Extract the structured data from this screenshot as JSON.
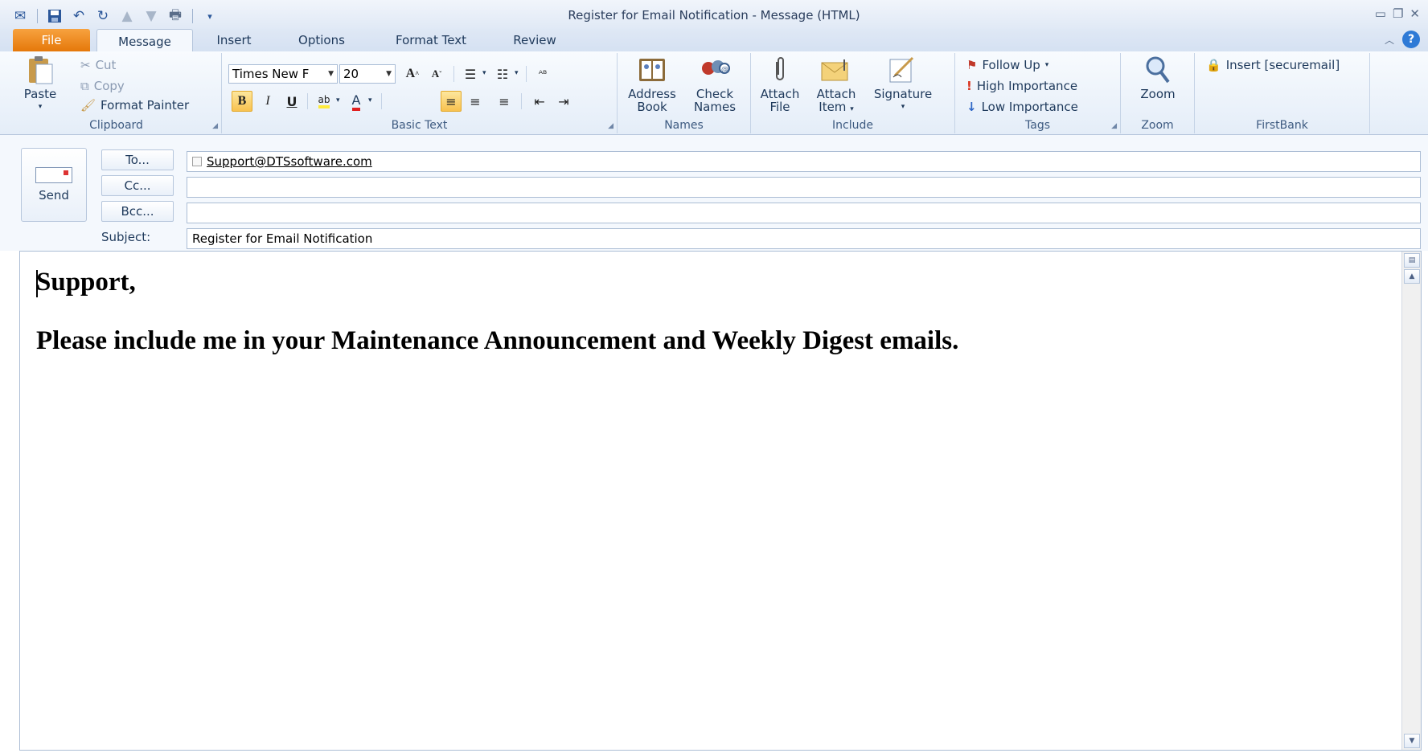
{
  "window": {
    "title": "Register for Email Notification  -  Message (HTML)"
  },
  "tabs": {
    "file": "File",
    "items": [
      "Message",
      "Insert",
      "Options",
      "Format Text",
      "Review"
    ]
  },
  "ribbon": {
    "clipboard": {
      "label": "Clipboard",
      "paste": "Paste",
      "cut": "Cut",
      "copy": "Copy",
      "format_painter": "Format Painter"
    },
    "basic_text": {
      "label": "Basic Text",
      "font_name": "Times New F",
      "font_size": "20"
    },
    "names": {
      "label": "Names",
      "address_book": [
        "Address",
        "Book"
      ],
      "check_names": [
        "Check",
        "Names"
      ]
    },
    "include": {
      "label": "Include",
      "attach_file": [
        "Attach",
        "File"
      ],
      "attach_item": [
        "Attach",
        "Item"
      ],
      "signature": "Signature"
    },
    "tags": {
      "label": "Tags",
      "follow_up": "Follow Up",
      "high_importance": "High Importance",
      "low_importance": "Low Importance"
    },
    "zoom": {
      "label": "Zoom",
      "zoom": "Zoom"
    },
    "firstbank": {
      "label": "FirstBank",
      "insert_securemail": "Insert [securemail]"
    }
  },
  "header": {
    "send": "Send",
    "to_button": "To...",
    "cc_button": "Cc...",
    "bcc_button": "Bcc...",
    "subject_label": "Subject:",
    "to_value": "Support@DTSsoftware.com",
    "cc_value": "",
    "bcc_value": "",
    "subject_value": "Register for Email Notification"
  },
  "body": {
    "lines": [
      "Support,",
      "Please include me in your Maintenance Announcement and Weekly Digest emails."
    ]
  }
}
